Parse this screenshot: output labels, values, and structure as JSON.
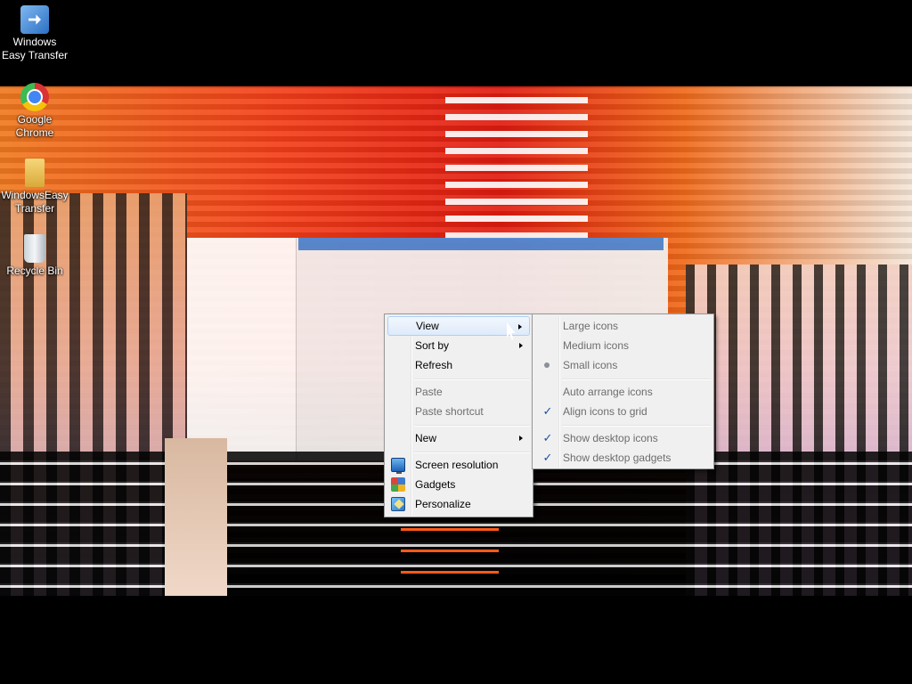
{
  "desktop": {
    "icons": [
      {
        "label": "Windows Easy Transfer",
        "icon": "easy-transfer-icon"
      },
      {
        "label": "Google Chrome",
        "icon": "chrome-icon"
      },
      {
        "label": "WindowsEasy Transfer",
        "icon": "folder-icon"
      },
      {
        "label": "Recycle Bin",
        "icon": "recycle-bin-icon"
      }
    ]
  },
  "context_menu": {
    "items": [
      {
        "label": "View",
        "submenu": true,
        "highlighted": true
      },
      {
        "label": "Sort by",
        "submenu": true
      },
      {
        "label": "Refresh"
      },
      {
        "label": "Paste",
        "disabled": true
      },
      {
        "label": "Paste shortcut",
        "disabled": true
      },
      {
        "label": "New",
        "submenu": true
      },
      {
        "label": "Screen resolution",
        "icon": "screen-resolution-icon"
      },
      {
        "label": "Gadgets",
        "icon": "gadgets-icon"
      },
      {
        "label": "Personalize",
        "icon": "personalize-icon"
      }
    ]
  },
  "view_submenu": {
    "items": [
      {
        "label": "Large icons",
        "disabled": true
      },
      {
        "label": "Medium icons",
        "disabled": true
      },
      {
        "label": "Small icons",
        "disabled": true,
        "selected": true
      },
      {
        "label": "Auto arrange icons",
        "disabled": true
      },
      {
        "label": "Align icons to grid",
        "disabled": true,
        "checked": true
      },
      {
        "label": "Show desktop icons",
        "disabled": true,
        "checked": true
      },
      {
        "label": "Show desktop gadgets",
        "disabled": true,
        "checked": true
      }
    ]
  },
  "glyphs": {
    "check": "✓"
  }
}
